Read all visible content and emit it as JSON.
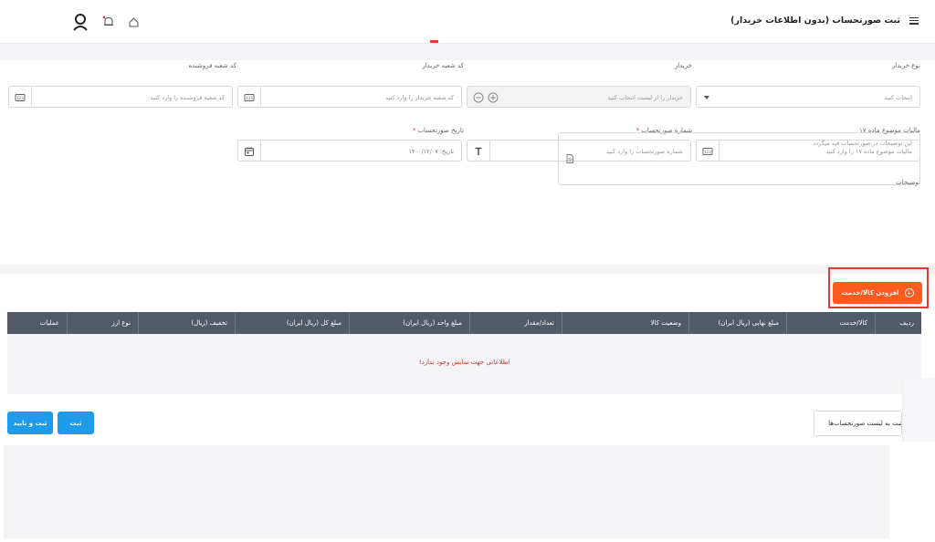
{
  "header": {
    "title": "ثبت صورتحساب (بدون اطلاعات خریدار)",
    "icons": [
      "menu-icon",
      "user-icon",
      "bell-icon",
      "home-icon"
    ]
  },
  "form": {
    "buyer_type": {
      "label": "نوع خریدار",
      "placeholder": "انتخاب کنید"
    },
    "buyer": {
      "label": "خریدار",
      "placeholder": "خریدار را از لیست انتخاب کنید"
    },
    "buyer_branch_code": {
      "label": "کد شعبه خریدار",
      "placeholder": "کد شعبه خریدار را وارد کنید"
    },
    "seller_branch_code": {
      "label": "کد شعبه فروشنده",
      "placeholder": "کد شعبه فروشنده را وارد کنید"
    },
    "article17_tax": {
      "label": "مالیات موضوع ماده ۱۷",
      "placeholder": "مالیات موضوع ماده ۱۷ را وارد کنید"
    },
    "invoice_number": {
      "label": "شماره صورتحساب",
      "required": "*",
      "placeholder": "شماره صورتحساب را وارد کنید"
    },
    "invoice_date": {
      "label": "تاریخ صورتحساب",
      "required": "*",
      "value": "تاریخ: ۱۴۰۰/۱۲/۰۷"
    },
    "description": {
      "label": "توضیحات",
      "placeholder": "این توضیحات در صورتحساب قید میگردد"
    }
  },
  "add_item_button": "افزودن کالا/خدمت",
  "table": {
    "columns": [
      "ردیف",
      "کالا/خدمت",
      "مبلغ نهایی (ریال ایران)",
      "وضعیت کالا",
      "تعداد/مقدار",
      "مبلغ واحد (ریال ایران)",
      "مبلغ کل (ریال ایران)",
      "تخفیف (ریال)",
      "نوع ارز",
      "عملیات"
    ],
    "empty_message": "اطلاعاتی جهت نمایش وجود ندارد!"
  },
  "actions": {
    "save": "ثبت",
    "save_confirm": "ثبت و تایید",
    "back": "بازگشت به لیست صورتحساب‌ها"
  },
  "colors": {
    "accent_orange": "#ff5a1f",
    "primary_blue": "#1e9be9",
    "table_header": "#515a66",
    "error_red": "#e53935"
  }
}
